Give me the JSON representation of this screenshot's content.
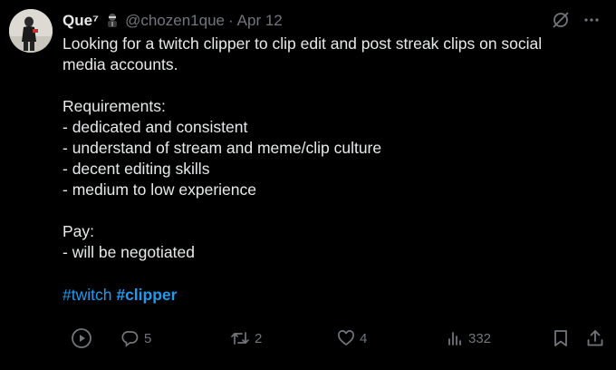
{
  "tweet": {
    "display_name": "Que⁷",
    "handle": "@chozen1que",
    "separator": "·",
    "date": "Apr 12",
    "body_lines": [
      "Looking for a twitch clipper to clip edit and post streak clips on social",
      "media accounts.",
      "",
      "Requirements:",
      "- dedicated and consistent",
      "- understand of stream and meme/clip culture",
      "- decent editing skills",
      "- medium to low experience",
      "",
      "Pay:",
      "- will be negotiated"
    ],
    "hashtags": [
      "#twitch",
      "#clipper"
    ]
  },
  "actions": {
    "replies": "5",
    "reposts": "2",
    "likes": "4",
    "views": "332"
  },
  "icons": {
    "top": [
      "grok-slash-icon",
      "more-icon"
    ],
    "actions": [
      "play-icon",
      "reply-icon",
      "repost-icon",
      "like-icon",
      "views-icon",
      "bookmark-icon",
      "share-icon"
    ]
  },
  "colors": {
    "background": "#000000",
    "text": "#e7e9ea",
    "secondary": "#71767b",
    "link": "#1d9bf0"
  }
}
